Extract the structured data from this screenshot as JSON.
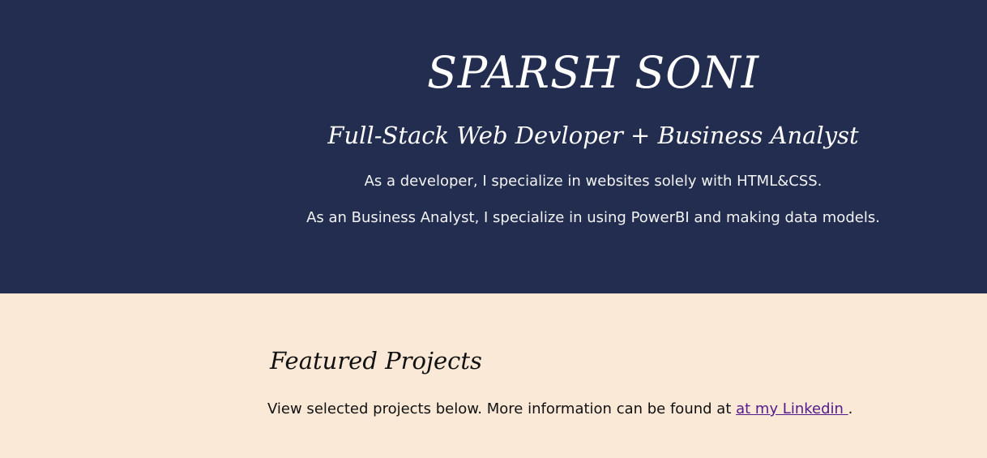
{
  "hero": {
    "title": "SPARSH SONI",
    "subtitle": "Full-Stack Web Devloper + Business Analyst",
    "line_1": "As a developer, I specialize in websites solely with HTML&CSS.",
    "line_2": "As an Business Analyst, I specialize in using PowerBI and making data models."
  },
  "projects": {
    "title": "Featured Projects",
    "text_before_link": "View selected projects below. More information can be found at ",
    "link_text": "at my Linkedin ",
    "text_after_link": "."
  },
  "colors": {
    "hero_background": "#222d4f",
    "page_background": "#fae9d7",
    "link": "#551a8b"
  }
}
